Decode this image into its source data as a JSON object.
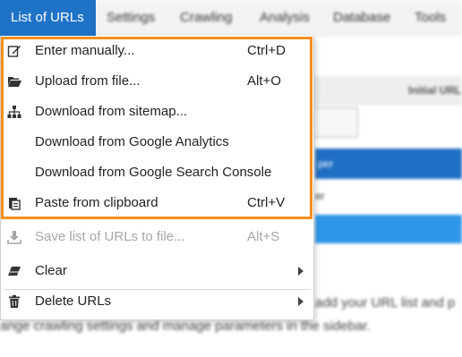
{
  "menubar": {
    "items": [
      "List of URLs",
      "Settings",
      "Crawling",
      "Analysis",
      "Database",
      "Tools"
    ]
  },
  "background": {
    "initial_label": "Initial URL",
    "blue_button_fragment": "per",
    "dots_fragment": "er",
    "line1": "add your URL list and p",
    "line2": "ange crawling settings and manage parameters in the sidebar."
  },
  "menu": {
    "items": [
      {
        "label": "Enter manually...",
        "shortcut": "Ctrl+D",
        "icon": "edit-icon"
      },
      {
        "label": "Upload from file...",
        "shortcut": "Alt+O",
        "icon": "folder-open-icon"
      },
      {
        "label": "Download from sitemap...",
        "shortcut": "",
        "icon": "sitemap-icon"
      },
      {
        "label": "Download from Google Analytics",
        "shortcut": "",
        "icon": ""
      },
      {
        "label": "Download from Google Search Console",
        "shortcut": "",
        "icon": ""
      },
      {
        "label": "Paste from clipboard",
        "shortcut": "Ctrl+V",
        "icon": "paste-icon"
      },
      {
        "label": "Save list of URLs to file...",
        "shortcut": "Alt+S",
        "icon": "download-icon",
        "disabled": true
      },
      {
        "label": "Clear",
        "shortcut": "",
        "icon": "eraser-icon",
        "submenu": true
      },
      {
        "label": "Delete URLs",
        "shortcut": "",
        "icon": "trash-icon",
        "submenu": true
      }
    ]
  },
  "colors": {
    "active_tab": "#1f73c7",
    "highlight_border": "#f5901e",
    "disabled_text": "#a6a6a6"
  }
}
